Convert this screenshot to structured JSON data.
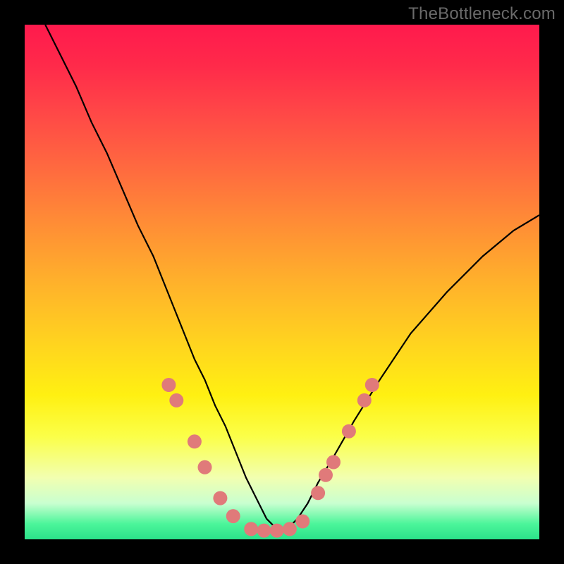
{
  "watermark": "TheBottleneck.com",
  "colors": {
    "frame": "#000000",
    "gradient_top": "#ff1a4d",
    "gradient_mid": "#ffd41f",
    "gradient_bottom": "#2be28a",
    "curve": "#000000",
    "markers": "#e07a7a"
  },
  "chart_data": {
    "type": "line",
    "title": "",
    "xlabel": "",
    "ylabel": "",
    "xlim": [
      0,
      100
    ],
    "ylim": [
      0,
      100
    ],
    "grid": false,
    "legend": false,
    "note": "Bottleneck-style curve. Values are estimated from pixel positions; no axis labels present in source image.",
    "series": [
      {
        "name": "curve",
        "x": [
          4,
          7,
          10,
          13,
          16,
          19,
          22,
          25,
          27,
          29,
          31,
          33,
          35,
          37,
          39,
          41,
          43,
          45,
          47,
          49,
          51,
          53,
          55,
          57,
          60,
          64,
          69,
          75,
          82,
          89,
          95,
          100
        ],
        "y": [
          100,
          94,
          88,
          81,
          75,
          68,
          61,
          55,
          50,
          45,
          40,
          35,
          31,
          26,
          22,
          17,
          12,
          8,
          4,
          2,
          2,
          4,
          7,
          11,
          16,
          23,
          31,
          40,
          48,
          55,
          60,
          63
        ]
      }
    ],
    "markers": {
      "name": "highlight-points",
      "note": "Pink dots near the bottom of the V, estimated positions.",
      "points": [
        {
          "x": 28,
          "y": 30
        },
        {
          "x": 29.5,
          "y": 27
        },
        {
          "x": 33,
          "y": 19
        },
        {
          "x": 35,
          "y": 14
        },
        {
          "x": 38,
          "y": 8
        },
        {
          "x": 40.5,
          "y": 4.5
        },
        {
          "x": 44,
          "y": 2
        },
        {
          "x": 46.5,
          "y": 1.7
        },
        {
          "x": 49,
          "y": 1.7
        },
        {
          "x": 51.5,
          "y": 2
        },
        {
          "x": 54,
          "y": 3.5
        },
        {
          "x": 57,
          "y": 9
        },
        {
          "x": 58.5,
          "y": 12.5
        },
        {
          "x": 60,
          "y": 15
        },
        {
          "x": 63,
          "y": 21
        },
        {
          "x": 66,
          "y": 27
        },
        {
          "x": 67.5,
          "y": 30
        }
      ]
    }
  }
}
